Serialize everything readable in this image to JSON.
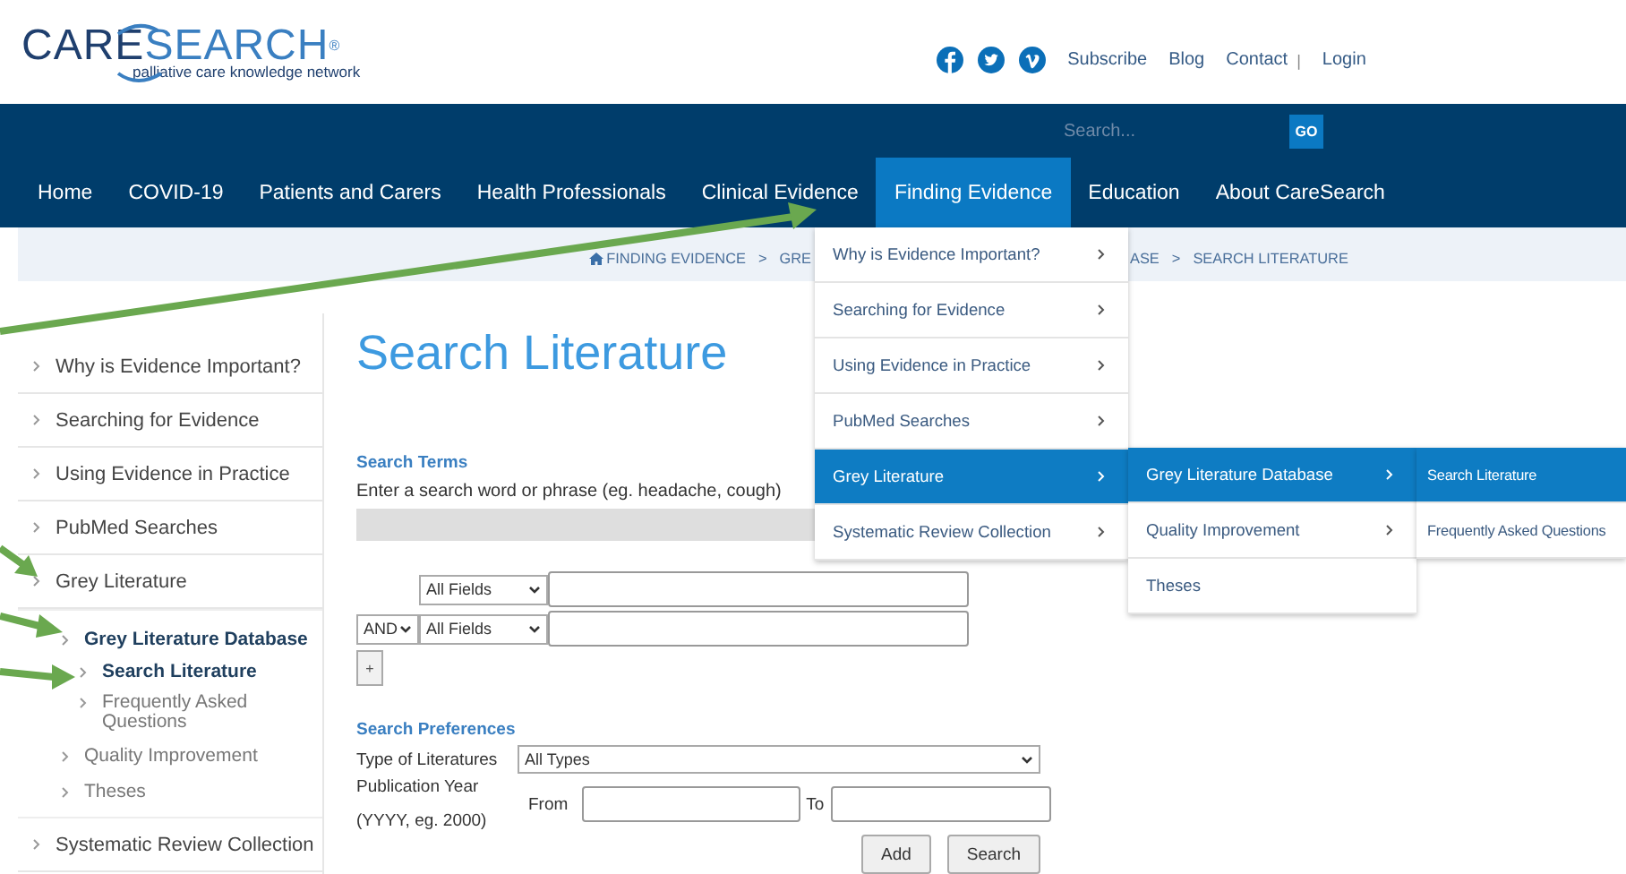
{
  "logo": {
    "name_part_1": "CARE",
    "name_part_2": "SEARCH",
    "registered": "®",
    "tagline": "palliative care knowledge network"
  },
  "header_links": [
    {
      "label": "Subscribe"
    },
    {
      "label": "Blog"
    },
    {
      "label": "Contact",
      "separator": "|"
    },
    {
      "label": "Login"
    }
  ],
  "site_search": {
    "placeholder": "Search...",
    "button": "GO"
  },
  "nav": [
    {
      "label": "Home",
      "selected": false
    },
    {
      "label": "COVID-19",
      "selected": false
    },
    {
      "label": "Patients and Carers",
      "selected": false
    },
    {
      "label": "Health Professionals",
      "selected": false
    },
    {
      "label": "Clinical Evidence",
      "selected": false
    },
    {
      "label": "Finding Evidence",
      "selected": true
    },
    {
      "label": "Education",
      "selected": false
    },
    {
      "label": "About CareSearch",
      "selected": false
    }
  ],
  "breadcrumb": {
    "visible_start": [
      "FINDING EVIDENCE",
      "GRE"
    ],
    "visible_end": [
      "ASE",
      "SEARCH LITERATURE"
    ],
    "separator": ">"
  },
  "dropdown": [
    {
      "items": [
        {
          "label": "Why is Evidence Important?",
          "selected": false,
          "submenu": true
        },
        {
          "label": "Searching for Evidence",
          "selected": false,
          "submenu": true
        },
        {
          "label": "Using Evidence in Practice",
          "selected": false,
          "submenu": true
        },
        {
          "label": "PubMed Searches",
          "selected": false,
          "submenu": true
        },
        {
          "label": "Grey Literature",
          "selected": true,
          "submenu": true
        },
        {
          "label": "Systematic Review Collection",
          "selected": false,
          "submenu": true
        }
      ]
    },
    {
      "items": [
        {
          "label": "Grey Literature Database",
          "selected": true,
          "submenu": true
        },
        {
          "label": "Quality Improvement",
          "selected": false,
          "submenu": true
        },
        {
          "label": "Theses",
          "selected": false,
          "submenu": false
        }
      ]
    },
    {
      "items": [
        {
          "label": "Search Literature",
          "selected": true,
          "submenu": false
        },
        {
          "label": "Frequently Asked Questions",
          "selected": false,
          "submenu": false
        }
      ]
    }
  ],
  "sidebar": {
    "items": [
      {
        "label": "Why is Evidence Important?"
      },
      {
        "label": "Searching for Evidence"
      },
      {
        "label": "Using Evidence in Practice"
      },
      {
        "label": "PubMed Searches"
      },
      {
        "label": "Grey Literature",
        "open": true,
        "children": [
          {
            "label": "Grey Literature Database",
            "open": true,
            "children": [
              {
                "label": "Search Literature",
                "selected": true
              },
              {
                "label": "Frequently Asked Questions",
                "selected": false
              }
            ]
          },
          {
            "label": "Quality Improvement"
          },
          {
            "label": "Theses"
          }
        ]
      },
      {
        "label": "Systematic Review Collection"
      }
    ]
  },
  "page_title": "Search Literature",
  "search_terms": {
    "heading": "Search Terms",
    "instruction": "Enter a search word or phrase (eg. headache, cough)"
  },
  "query_rows": [
    {
      "field": "All Fields"
    },
    {
      "operator": "AND",
      "field": "All Fields"
    }
  ],
  "add_row_button": "+",
  "preferences": {
    "heading": "Search Preferences",
    "type_label": "Type of Literatures",
    "type_value": "All Types",
    "year_label": "Publication Year",
    "year_hint": "(YYYY, eg. 2000)",
    "from_label": "From",
    "to_label": "To"
  },
  "buttons": [
    "Add",
    "Search"
  ]
}
